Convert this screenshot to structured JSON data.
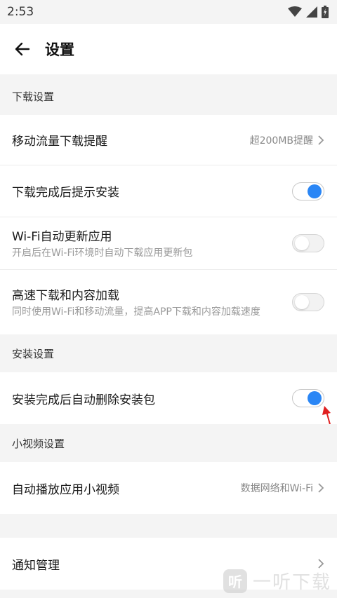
{
  "status_bar": {
    "time": "2:53"
  },
  "app_bar": {
    "title": "设置"
  },
  "sections": {
    "download": {
      "header": "下载设置",
      "mobile_data_reminder": {
        "label": "移动流量下载提醒",
        "value": "超200MB提醒"
      },
      "prompt_install": {
        "label": "下载完成后提示安装",
        "enabled": true
      },
      "wifi_auto_update": {
        "label": "Wi-Fi自动更新应用",
        "sub": "开启后在Wi-Fi环境时自动下载应用更新包",
        "enabled": false
      },
      "high_speed": {
        "label": "高速下载和内容加载",
        "sub": "同时使用Wi-Fi和移动流量，提高APP下载和内容加载速度",
        "enabled": false
      }
    },
    "install": {
      "header": "安装设置",
      "auto_delete": {
        "label": "安装完成后自动删除安装包",
        "enabled": true
      }
    },
    "video": {
      "header": "小视频设置",
      "autoplay": {
        "label": "自动播放应用小视频",
        "value": "数据网络和Wi-Fi"
      }
    },
    "notification": {
      "label": "通知管理"
    }
  },
  "watermark": {
    "logo": "听",
    "text": "一听下载"
  },
  "colors": {
    "accent": "#2a86f5",
    "background": "#f4f4f4",
    "annotation_arrow": "#e02020"
  }
}
